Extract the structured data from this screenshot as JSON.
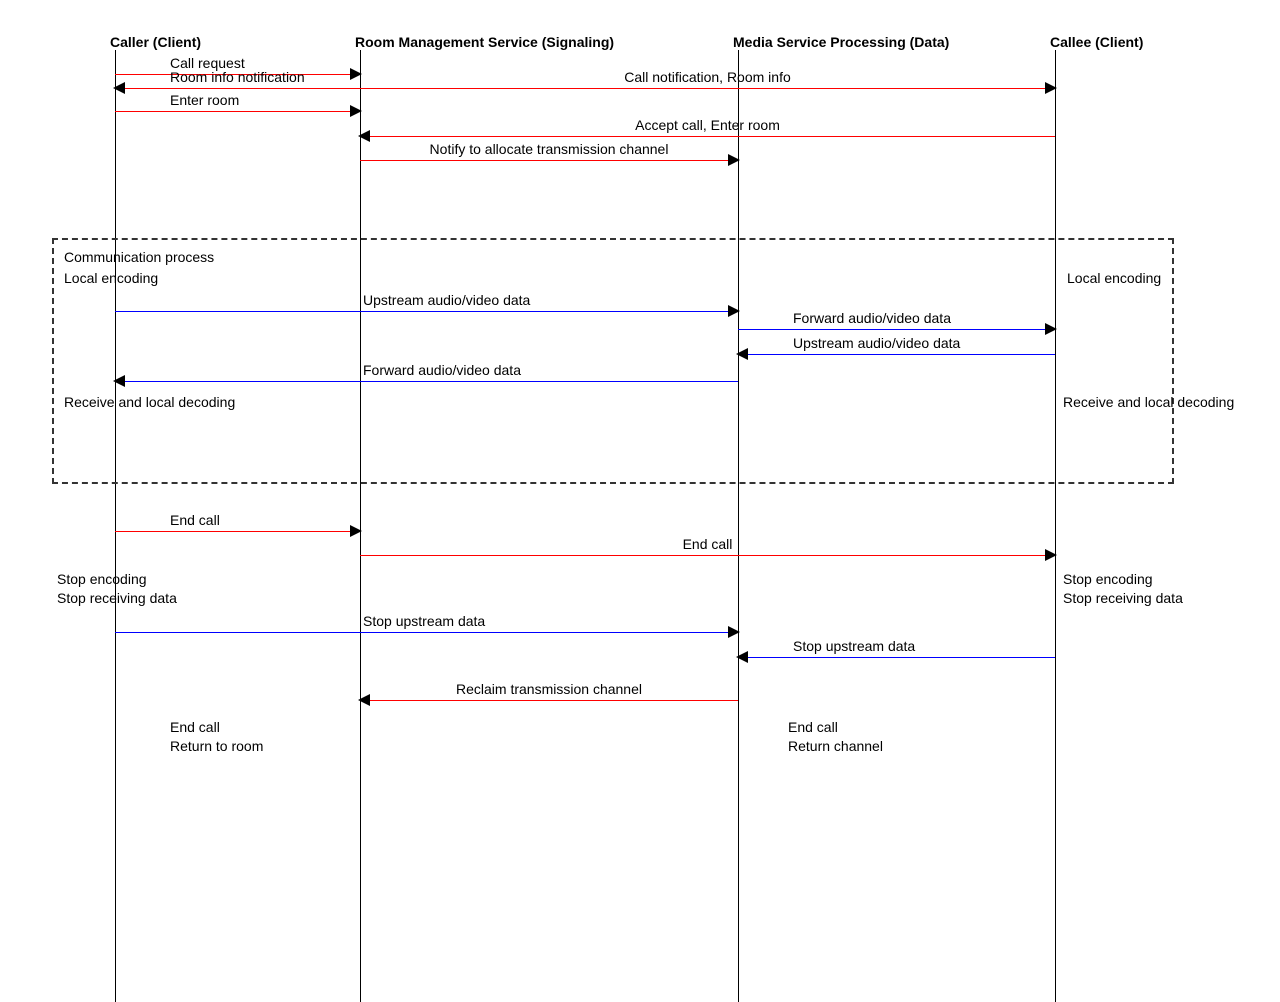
{
  "actors": {
    "caller": "Caller (Client)",
    "rms": "Room Management Service (Signaling)",
    "media": "Media Service Processing (Data)",
    "callee": "Callee (Client)"
  },
  "messages": {
    "m1": "Call request",
    "m2": "Room info notification",
    "m3": "Call notification, Room info",
    "m4": "Enter room",
    "m5": "Accept call, Enter room",
    "m6": "Notify to allocate transmission channel",
    "m7": "Upstream audio/video data",
    "m8": "Forward audio/video data",
    "m9": "Upstream audio/video data",
    "m10": "Forward audio/video data",
    "m11": "End call",
    "m12": "End call",
    "m13": "Stop upstream data",
    "m14": "Stop upstream data",
    "m15": "Reclaim transmission channel"
  },
  "notes": {
    "region_title": "Communication process",
    "local_enc_l": "Local encoding",
    "local_enc_r": "Local encoding",
    "recv_dec_l": "Receive and local decoding",
    "recv_dec_r": "Receive and local decoding",
    "stop_enc_l": "Stop encoding\nStop receiving data",
    "stop_enc_r": "Stop encoding\nStop receiving data",
    "end_l": "End call\nReturn to room",
    "end_r": "End call\nReturn channel"
  },
  "x": {
    "caller": 115,
    "rms": 360,
    "media": 738,
    "callee": 1055
  }
}
